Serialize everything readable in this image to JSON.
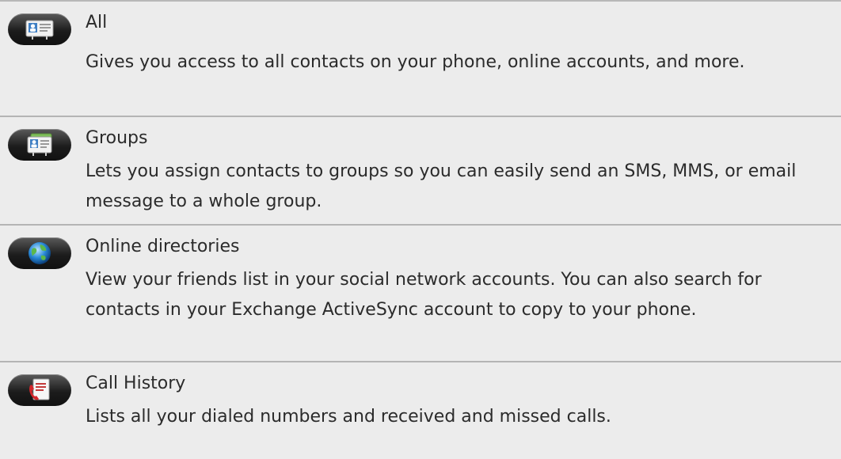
{
  "items": [
    {
      "icon": "contacts-card-icon",
      "title": "All",
      "description": "Gives you access to all contacts on your phone, online accounts, and more."
    },
    {
      "icon": "contact-groups-icon",
      "title": "Groups",
      "description": "Lets you assign contacts to groups so you can easily send an SMS, MMS, or email message to a whole group."
    },
    {
      "icon": "globe-icon",
      "title": "Online directories",
      "description": "View your friends list in your social network accounts. You can also search for contacts in your Exchange ActiveSync account to copy to your phone."
    },
    {
      "icon": "call-history-icon",
      "title": "Call History",
      "description": "Lists all your dialed numbers and received and missed calls."
    }
  ]
}
